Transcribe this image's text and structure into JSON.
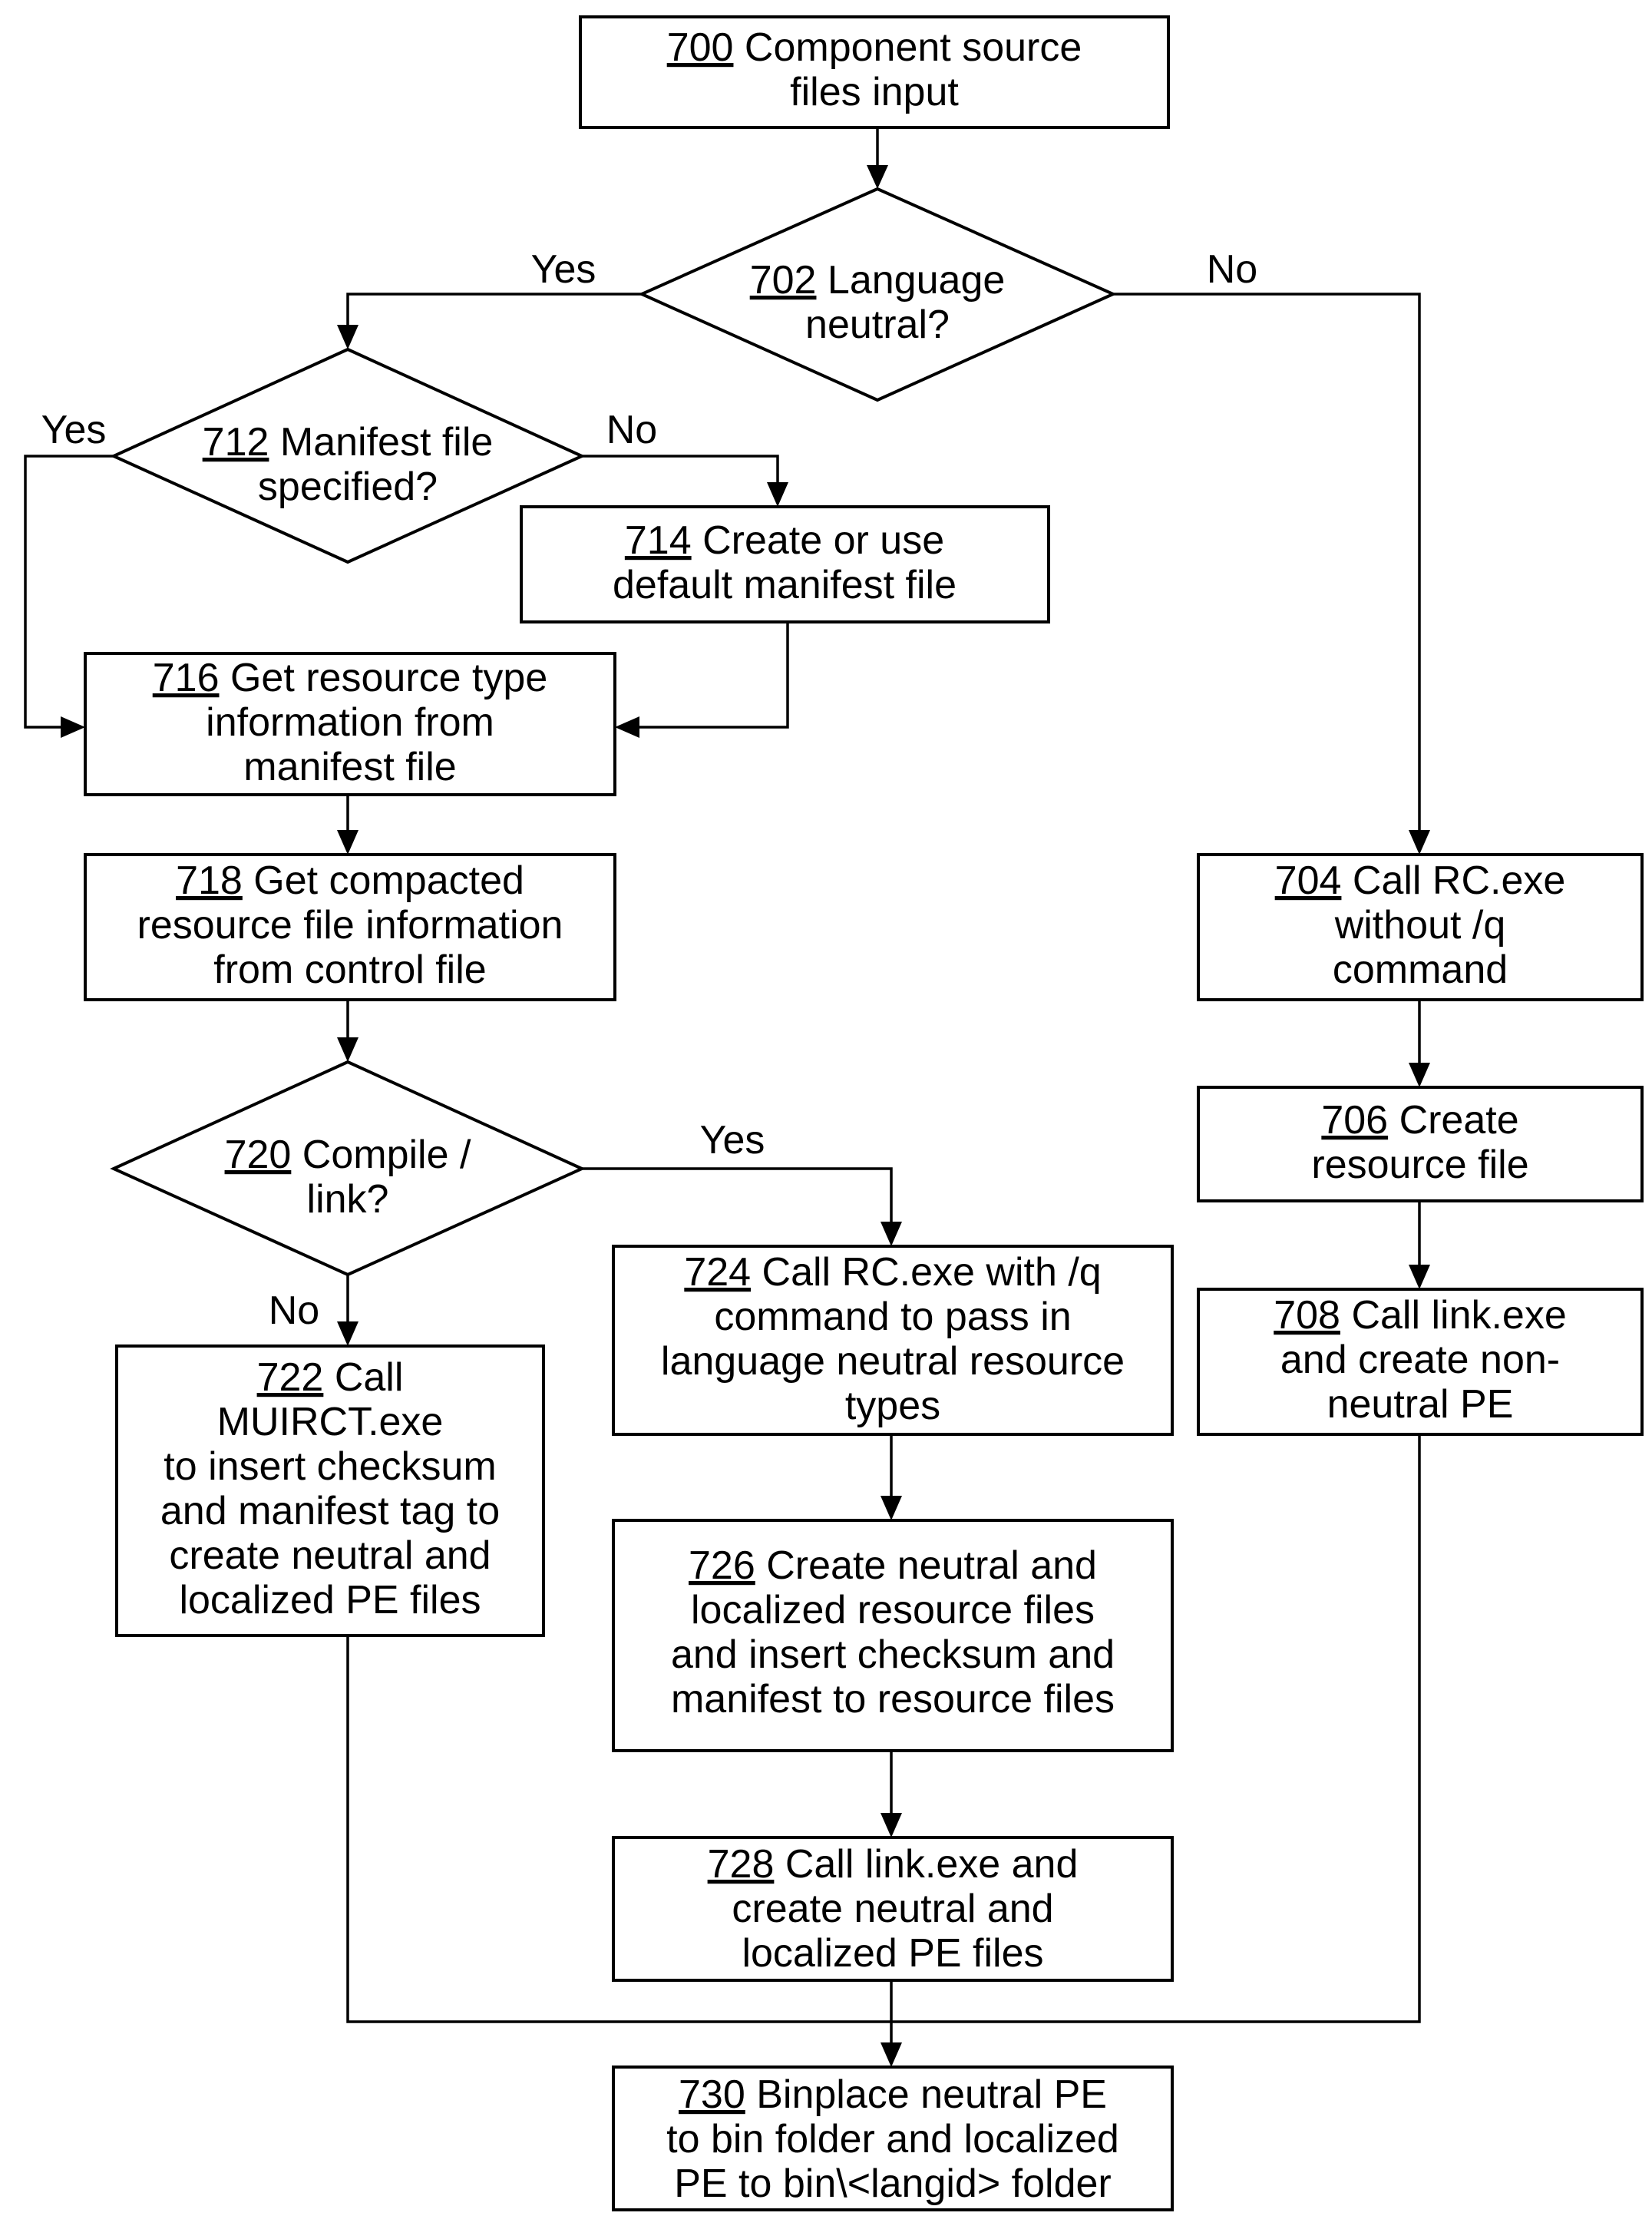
{
  "figure": {
    "nodes": {
      "n700": {
        "id": "700",
        "type": "process",
        "lines": [
          "Component source",
          "files input"
        ]
      },
      "n702": {
        "id": "702",
        "type": "decision",
        "lines": [
          "Language",
          "neutral?"
        ]
      },
      "n704": {
        "id": "704",
        "type": "process",
        "lines": [
          "Call RC.exe",
          "without /q",
          "command"
        ]
      },
      "n706": {
        "id": "706",
        "type": "process",
        "lines": [
          "Create",
          "resource file"
        ]
      },
      "n708": {
        "id": "708",
        "type": "process",
        "lines": [
          "Call link.exe",
          "and create non-",
          "neutral PE"
        ]
      },
      "n712": {
        "id": "712",
        "type": "decision",
        "lines": [
          "Manifest file",
          "specified?"
        ]
      },
      "n714": {
        "id": "714",
        "type": "process",
        "lines": [
          "Create or use",
          "default manifest file"
        ]
      },
      "n716": {
        "id": "716",
        "type": "process",
        "lines": [
          "Get resource type",
          "information from",
          "manifest file"
        ]
      },
      "n718": {
        "id": "718",
        "type": "process",
        "lines": [
          "Get compacted",
          "resource file information",
          "from control file"
        ]
      },
      "n720": {
        "id": "720",
        "type": "decision",
        "lines": [
          "Compile /",
          "link?"
        ]
      },
      "n722": {
        "id": "722",
        "type": "process",
        "lines": [
          "Call",
          "MUIRCT.exe",
          "to insert checksum",
          "and manifest tag to",
          "create neutral and",
          "localized PE files"
        ]
      },
      "n724": {
        "id": "724",
        "type": "process",
        "lines": [
          "Call RC.exe with /q",
          "command to pass in",
          "language neutral resource",
          "types"
        ]
      },
      "n726": {
        "id": "726",
        "type": "process",
        "lines": [
          "Create neutral and",
          "localized resource files",
          "and insert checksum and",
          "manifest to resource files"
        ]
      },
      "n728": {
        "id": "728",
        "type": "process",
        "lines": [
          "Call link.exe and",
          "create neutral and",
          "localized PE files"
        ]
      },
      "n730": {
        "id": "730",
        "type": "process",
        "lines": [
          "Binplace neutral PE",
          "to bin folder and localized",
          "PE to bin\\<langid> folder"
        ]
      }
    },
    "edge_labels": {
      "e702_yes": "Yes",
      "e702_no": "No",
      "e712_yes": "Yes",
      "e712_no": "No",
      "e720_yes": "Yes",
      "e720_no": "No"
    },
    "edges": [
      {
        "from": "700",
        "to": "702"
      },
      {
        "from": "702",
        "to": "712",
        "label": "Yes"
      },
      {
        "from": "702",
        "to": "704",
        "label": "No"
      },
      {
        "from": "712",
        "to": "716",
        "label": "Yes"
      },
      {
        "from": "712",
        "to": "714",
        "label": "No"
      },
      {
        "from": "714",
        "to": "716"
      },
      {
        "from": "716",
        "to": "718"
      },
      {
        "from": "718",
        "to": "720"
      },
      {
        "from": "720",
        "to": "724",
        "label": "Yes"
      },
      {
        "from": "720",
        "to": "722",
        "label": "No"
      },
      {
        "from": "724",
        "to": "726"
      },
      {
        "from": "726",
        "to": "728"
      },
      {
        "from": "704",
        "to": "706"
      },
      {
        "from": "706",
        "to": "708"
      },
      {
        "from": "722",
        "to": "730"
      },
      {
        "from": "728",
        "to": "730"
      },
      {
        "from": "708",
        "to": "730"
      }
    ]
  }
}
